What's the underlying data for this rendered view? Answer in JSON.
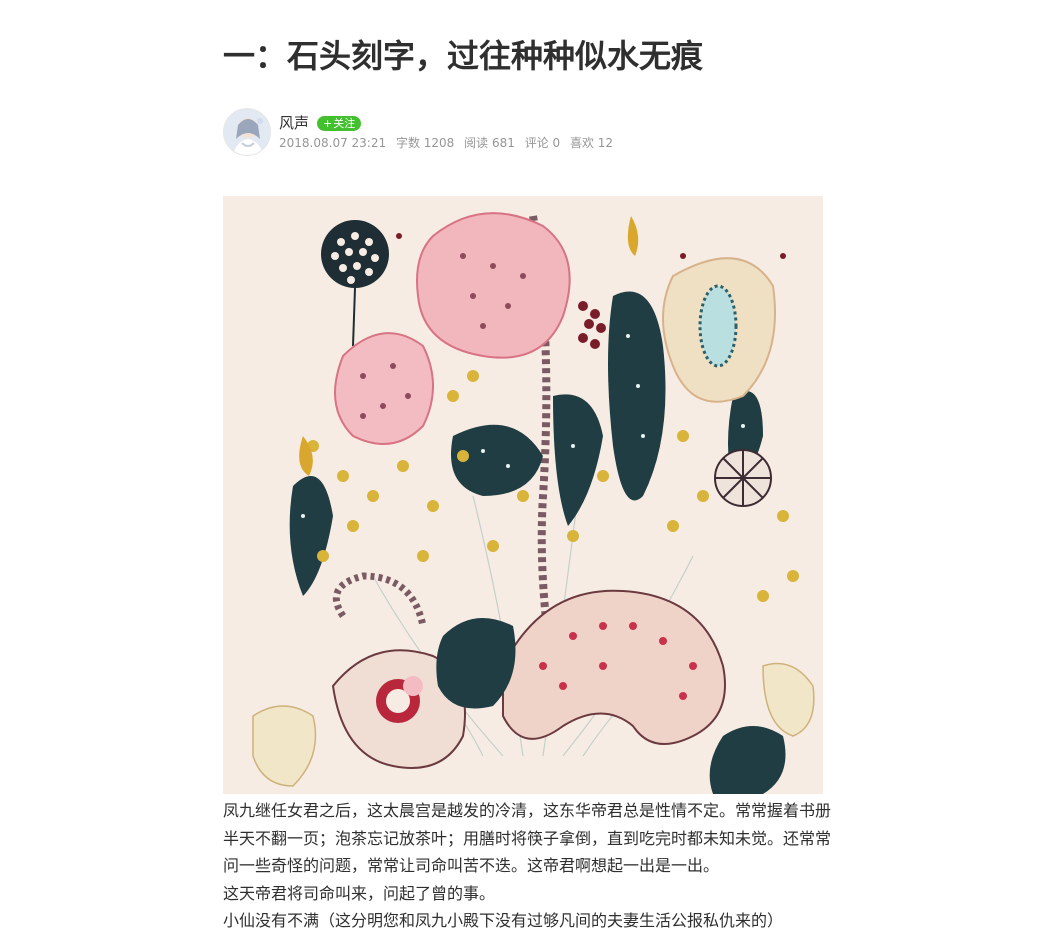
{
  "article": {
    "title": "一：石头刻字，过往种种似水无痕",
    "author": {
      "name": "风声",
      "follow_label": "关注",
      "follow_icon": "plus-icon"
    },
    "meta": {
      "publish_time": "2018.08.07 23:21",
      "word_count": "字数 1208",
      "views": "阅读 681",
      "comments": "评论 0",
      "likes": "喜欢 12"
    },
    "image": {
      "subject": "flower-illustration"
    },
    "paragraphs": [
      "凤九继任女君之后，这太晨宫是越发的冷清，这东华帝君总是性情不定。常常握着书册半天不翻一页；泡茶忘记放茶叶；用膳时将筷子拿倒，直到吃完时都未知未觉。还常常问一些奇怪的问题，常常让司命叫苦不迭。这帝君啊想起一出是一出。",
      "这天帝君将司命叫来，问起了曾的事。",
      "小仙没有不满（这分明您和凤九小殿下没有过够凡间的夫妻生活公报私仇来的）"
    ]
  },
  "colors": {
    "follow_green": "#42c02e",
    "meta_gray": "#969696",
    "title_text": "#2f2f2f",
    "illustration_bg": "#f7ece4"
  }
}
